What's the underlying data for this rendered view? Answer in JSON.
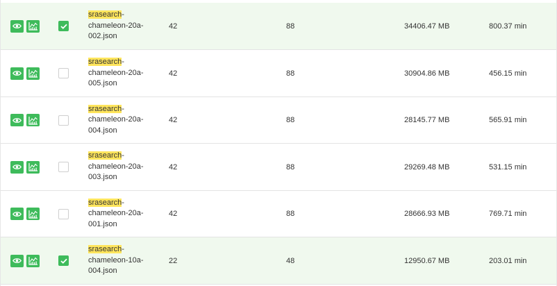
{
  "accent_color": "#3ebb5b",
  "highlight_color": "#ffe55c",
  "rows": [
    {
      "selected": true,
      "checked": true,
      "name_highlight": "srasearch",
      "name_line1_rest": "-",
      "name_line2": "chameleon-20a-",
      "name_line3": "002.json",
      "col1": "42",
      "col2": "88",
      "size": "34406.47 MB",
      "time": "800.37 min"
    },
    {
      "selected": false,
      "checked": false,
      "name_highlight": "srasearch",
      "name_line1_rest": "-",
      "name_line2": "chameleon-20a-",
      "name_line3": "005.json",
      "col1": "42",
      "col2": "88",
      "size": "30904.86 MB",
      "time": "456.15 min"
    },
    {
      "selected": false,
      "checked": false,
      "name_highlight": "srasearch",
      "name_line1_rest": "-",
      "name_line2": "chameleon-20a-",
      "name_line3": "004.json",
      "col1": "42",
      "col2": "88",
      "size": "28145.77 MB",
      "time": "565.91 min"
    },
    {
      "selected": false,
      "checked": false,
      "name_highlight": "srasearch",
      "name_line1_rest": "-",
      "name_line2": "chameleon-20a-",
      "name_line3": "003.json",
      "col1": "42",
      "col2": "88",
      "size": "29269.48 MB",
      "time": "531.15 min"
    },
    {
      "selected": false,
      "checked": false,
      "name_highlight": "srasearch",
      "name_line1_rest": "-",
      "name_line2": "chameleon-20a-",
      "name_line3": "001.json",
      "col1": "42",
      "col2": "88",
      "size": "28666.93 MB",
      "time": "769.71 min"
    },
    {
      "selected": true,
      "checked": true,
      "name_highlight": "srasearch",
      "name_line1_rest": "-",
      "name_line2": "chameleon-10a-",
      "name_line3": "004.json",
      "col1": "22",
      "col2": "48",
      "size": "12950.67 MB",
      "time": "203.01 min"
    }
  ]
}
